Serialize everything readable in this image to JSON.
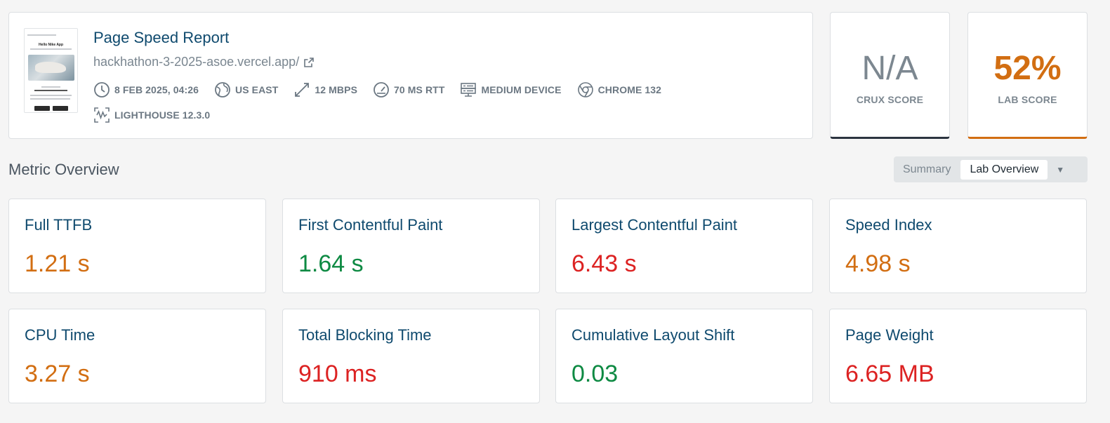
{
  "header": {
    "title": "Page Speed Report",
    "url": "hackhathon-3-2025-asoe.vercel.app/",
    "thumbnail_title": "Hello Nike App",
    "meta": {
      "date": "8 FEB 2025, 04:26",
      "location": "US EAST",
      "bandwidth": "12 MBPS",
      "rtt": "70 MS RTT",
      "device": "MEDIUM DEVICE",
      "browser": "CHROME 132",
      "lighthouse": "LIGHTHOUSE 12.3.0"
    }
  },
  "scores": {
    "crux": {
      "value": "N/A",
      "label": "CRUX SCORE"
    },
    "lab": {
      "value": "52%",
      "label": "LAB SCORE"
    }
  },
  "overview": {
    "title": "Metric Overview",
    "options": [
      "Summary",
      "Lab Overview"
    ],
    "selected": "Lab Overview"
  },
  "metrics": [
    {
      "name": "Full TTFB",
      "value": "1.21 s",
      "status": "orange"
    },
    {
      "name": "First Contentful Paint",
      "value": "1.64 s",
      "status": "green"
    },
    {
      "name": "Largest Contentful Paint",
      "value": "6.43 s",
      "status": "red"
    },
    {
      "name": "Speed Index",
      "value": "4.98 s",
      "status": "orange"
    },
    {
      "name": "CPU Time",
      "value": "3.27 s",
      "status": "orange"
    },
    {
      "name": "Total Blocking Time",
      "value": "910 ms",
      "status": "red"
    },
    {
      "name": "Cumulative Layout Shift",
      "value": "0.03",
      "status": "green"
    },
    {
      "name": "Page Weight",
      "value": "6.65 MB",
      "status": "red"
    }
  ],
  "colors": {
    "orange": "#d26e12",
    "green": "#0e8a43",
    "red": "#dc2222",
    "title_blue": "#0f4a6e"
  },
  "icons": [
    "clock-icon",
    "globe-icon",
    "bandwidth-icon",
    "gauge-icon",
    "server-icon",
    "chrome-icon",
    "lighthouse-icon",
    "external-link-icon",
    "caret-down-icon"
  ]
}
